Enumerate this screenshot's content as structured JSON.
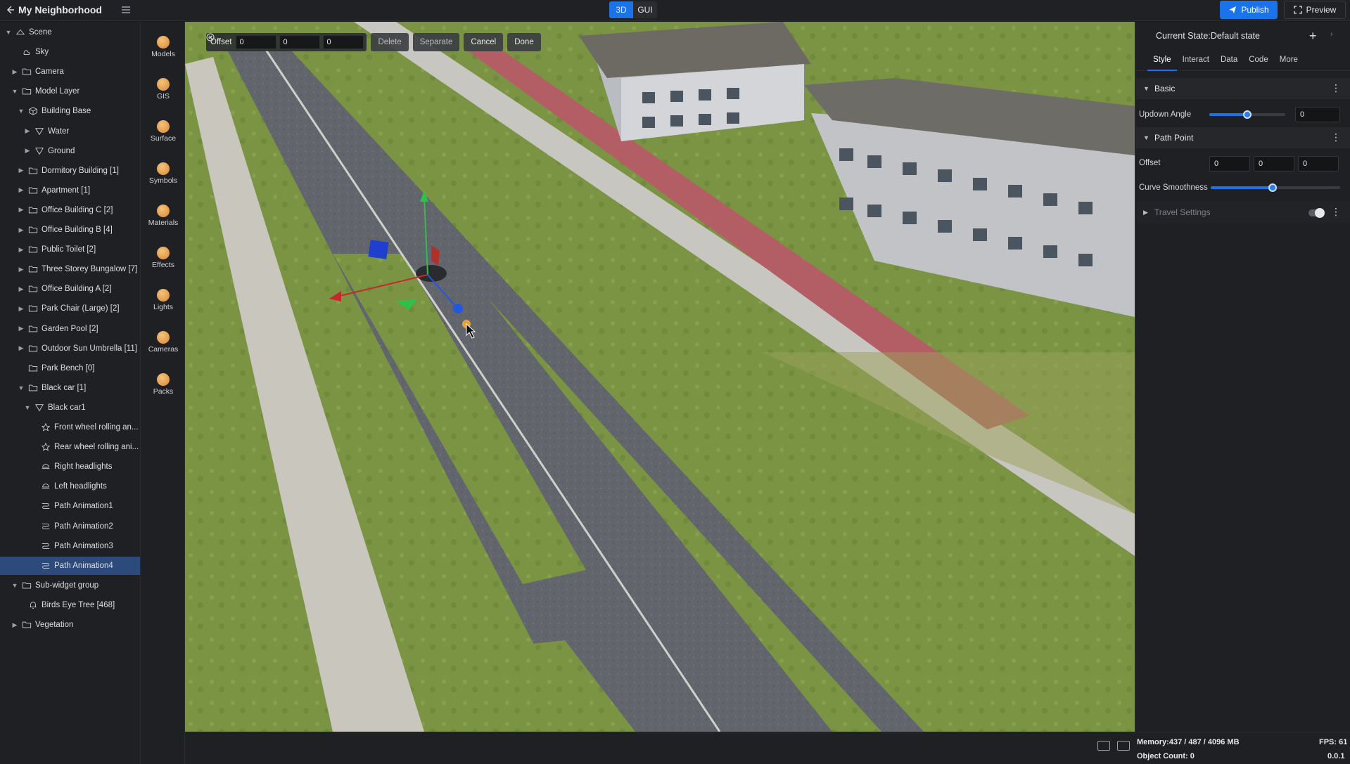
{
  "app": {
    "title": "My Neighborhood"
  },
  "mode": {
    "options": [
      "3D",
      "GUI"
    ],
    "active": "3D"
  },
  "header": {
    "publish_label": "Publish",
    "preview_label": "Preview"
  },
  "tree": [
    {
      "label": "Scene",
      "depth": 0,
      "expand": "open",
      "icon": "scene"
    },
    {
      "label": "Sky",
      "depth": 1,
      "expand": "none",
      "icon": "sky"
    },
    {
      "label": "Camera",
      "depth": 1,
      "expand": "closed",
      "icon": "folder"
    },
    {
      "label": "Model Layer",
      "depth": 1,
      "expand": "open",
      "icon": "folder"
    },
    {
      "label": "Building Base",
      "depth": 2,
      "expand": "open",
      "icon": "cube"
    },
    {
      "label": "Water",
      "depth": 3,
      "expand": "closed",
      "icon": "triangle"
    },
    {
      "label": "Ground",
      "depth": 3,
      "expand": "closed",
      "icon": "triangle"
    },
    {
      "label": "Dormitory Building [1]",
      "depth": 2,
      "expand": "closed",
      "icon": "folder"
    },
    {
      "label": "Apartment [1]",
      "depth": 2,
      "expand": "closed",
      "icon": "folder"
    },
    {
      "label": "Office Building C [2]",
      "depth": 2,
      "expand": "closed",
      "icon": "folder"
    },
    {
      "label": "Office Building B [4]",
      "depth": 2,
      "expand": "closed",
      "icon": "folder"
    },
    {
      "label": "Public Toilet [2]",
      "depth": 2,
      "expand": "closed",
      "icon": "folder"
    },
    {
      "label": "Three Storey Bungalow [7]",
      "depth": 2,
      "expand": "closed",
      "icon": "folder"
    },
    {
      "label": "Office Building A [2]",
      "depth": 2,
      "expand": "closed",
      "icon": "folder"
    },
    {
      "label": "Park Chair (Large) [2]",
      "depth": 2,
      "expand": "closed",
      "icon": "folder"
    },
    {
      "label": "Garden Pool [2]",
      "depth": 2,
      "expand": "closed",
      "icon": "folder"
    },
    {
      "label": "Outdoor Sun Umbrella [11]",
      "depth": 2,
      "expand": "closed",
      "icon": "folder"
    },
    {
      "label": "Park Bench [0]",
      "depth": 2,
      "expand": "none",
      "icon": "folder"
    },
    {
      "label": "Black car [1]",
      "depth": 2,
      "expand": "open",
      "icon": "folder"
    },
    {
      "label": "Black car1",
      "depth": 3,
      "expand": "open",
      "icon": "triangle"
    },
    {
      "label": "Front wheel rolling an...",
      "depth": 4,
      "expand": "none",
      "icon": "star"
    },
    {
      "label": "Rear wheel rolling ani...",
      "depth": 4,
      "expand": "none",
      "icon": "star"
    },
    {
      "label": "Right headlights",
      "depth": 4,
      "expand": "none",
      "icon": "light"
    },
    {
      "label": "Left headlights",
      "depth": 4,
      "expand": "none",
      "icon": "light"
    },
    {
      "label": "Path Animation1",
      "depth": 4,
      "expand": "none",
      "icon": "path"
    },
    {
      "label": "Path Animation2",
      "depth": 4,
      "expand": "none",
      "icon": "path"
    },
    {
      "label": "Path Animation3",
      "depth": 4,
      "expand": "none",
      "icon": "path"
    },
    {
      "label": "Path Animation4",
      "depth": 4,
      "expand": "none",
      "icon": "path",
      "selected": true
    },
    {
      "label": "Sub-widget group",
      "depth": 1,
      "expand": "open",
      "icon": "folder"
    },
    {
      "label": "Birds Eye Tree [468]",
      "depth": 2,
      "expand": "none",
      "icon": "bell"
    },
    {
      "label": "Vegetation",
      "depth": 1,
      "expand": "closed",
      "icon": "folder"
    }
  ],
  "rail": [
    "Models",
    "GIS",
    "Surface",
    "Symbols",
    "Materials",
    "Effects",
    "Lights",
    "Cameras",
    "Packs"
  ],
  "toolbar3d": {
    "offset_label": "Offset",
    "offset_values": [
      "0",
      "0",
      "0"
    ],
    "delete_label": "Delete",
    "separate_label": "Separate",
    "cancel_label": "Cancel",
    "done_label": "Done"
  },
  "panel": {
    "state_label": "Current State:Default state",
    "tabs": [
      "Style",
      "Interact",
      "Data",
      "Code",
      "More"
    ],
    "active_tab": "Style",
    "basic": {
      "title": "Basic",
      "updown_label": "Updown Angle",
      "updown_value": "0",
      "updown_level": 0.5
    },
    "path_point": {
      "title": "Path Point",
      "offset_label": "Offset",
      "offset_values": [
        "0",
        "0",
        "0"
      ],
      "smooth_label": "Curve Smoothness",
      "smooth_level": 0.48
    },
    "travel": {
      "title": "Travel Settings",
      "enabled": false
    }
  },
  "status": {
    "memory": "Memory:437 / 487 / 4096 MB",
    "fps": "FPS: 61",
    "object_count": "Object Count: 0",
    "version": "0.0.1"
  },
  "colors": {
    "accent": "#1a73e8",
    "selected_row": "#2c4a7c"
  }
}
